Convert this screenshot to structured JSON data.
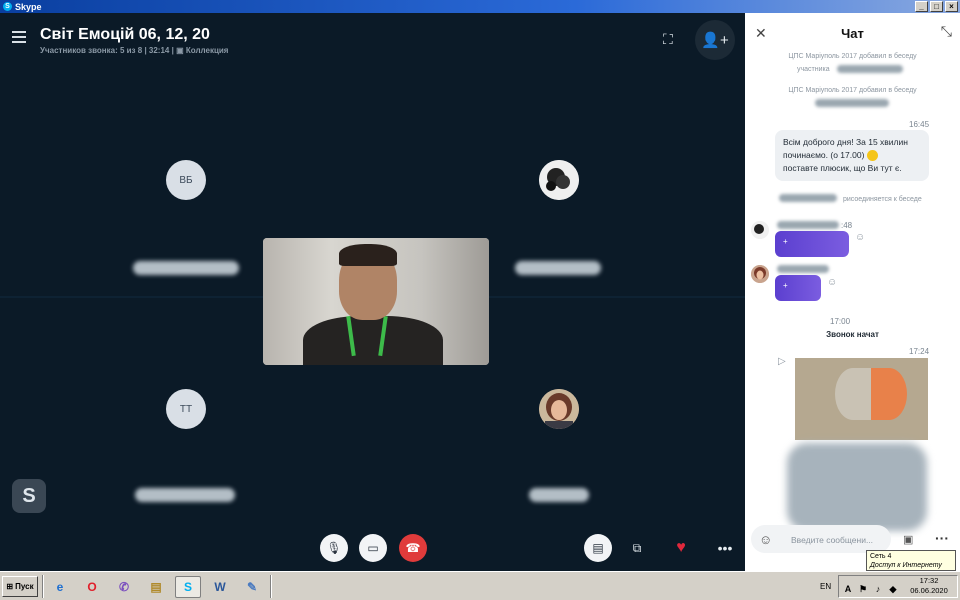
{
  "window": {
    "title": "Skype",
    "controls": [
      "_",
      "□",
      "×"
    ]
  },
  "call": {
    "title": "Світ Емоцій 06, 12, 20",
    "participants_text": "Участников звонка: 5 из 8",
    "duration": "32:14",
    "collection_label": "Коллекция",
    "participants": [
      {
        "initials": "ВБ"
      },
      {
        "initials": ""
      },
      {
        "initials": "ТТ"
      },
      {
        "initials": ""
      }
    ],
    "controls": {
      "mic": "microphone-icon",
      "video": "video-camera-icon",
      "hangup": "hang-up-icon",
      "chat": "chat-icon",
      "switch": "switch-view-icon",
      "react": "heart-icon",
      "more": "more-icon"
    }
  },
  "chat": {
    "title": "Чат",
    "messages": {
      "sys1_a": "ЦПС Маріуполь 2017 добавил в беседу",
      "sys1_b": "участника",
      "sys2": "ЦПС Маріуполь 2017 добавил в беседу",
      "time1": "16:45",
      "bubble_line1": "Всім доброго дня! За 15 хвилин",
      "bubble_line2": "починаємо. (о 17.00)",
      "bubble_line3": "поставте плюсик, що Ви тут є.",
      "joined_suffix": "рисоединяется к беседе",
      "time_msg1": ":48",
      "plus1": "+",
      "plus2": "+",
      "time2": "17:00",
      "call_started": "Звонок начат",
      "time3": "17:24"
    },
    "compose_placeholder": "Введите сообщени..."
  },
  "tooltip": {
    "line1": "Сеть  4",
    "line2": "Доступ к Интернету"
  },
  "taskbar": {
    "start_label": "Пуск",
    "lang": "EN",
    "time": "17:32",
    "date": "06.06.2020"
  }
}
